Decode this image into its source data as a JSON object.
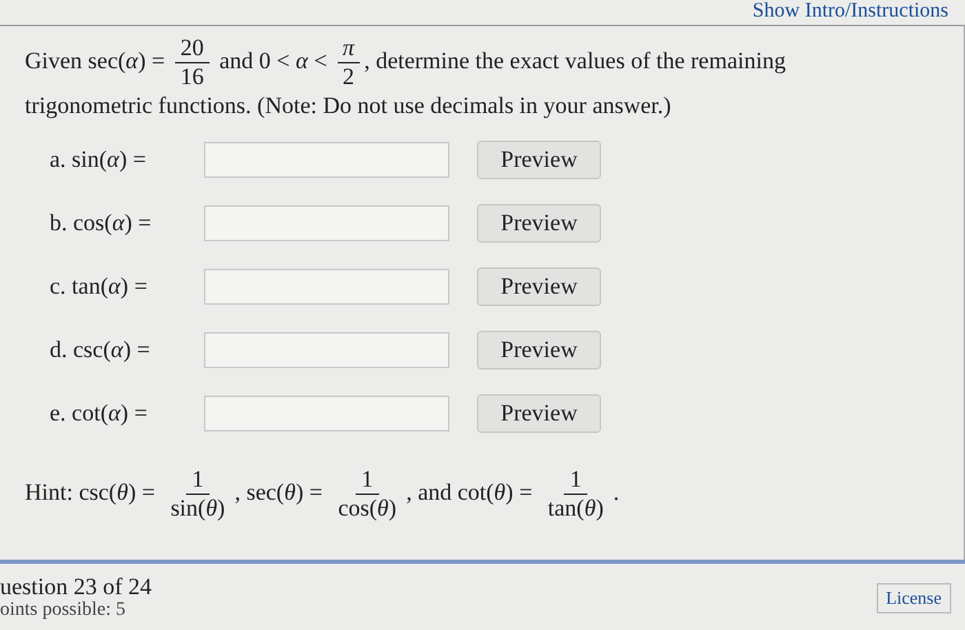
{
  "instructions_link": "Show Intro/Instructions",
  "question": [
    {
      "kind": "text",
      "text": "Given sec(*α*) = "
    },
    {
      "kind": "frac",
      "num": "20",
      "den": "16"
    },
    {
      "kind": "text",
      "text": " and 0 < *α* < "
    },
    {
      "kind": "frac",
      "num": "*π*",
      "den": "2"
    },
    {
      "kind": "text",
      "text": ", determine the exact values of the remaining"
    },
    {
      "kind": "line",
      "text": "trigonometric functions. (Note: Do not use decimals in your answer.)"
    }
  ],
  "answers": [
    {
      "label": "a. sin(*α*) =",
      "button": "Preview"
    },
    {
      "label": "b. cos(*α*) =",
      "button": "Preview"
    },
    {
      "label": "c. tan(*α*) =",
      "button": "Preview"
    },
    {
      "label": "d. csc(*α*) =",
      "button": "Preview"
    },
    {
      "label": "e. cot(*α*) =",
      "button": "Preview"
    }
  ],
  "hint": [
    {
      "kind": "text",
      "text": "Hint: csc(*θ*) = "
    },
    {
      "kind": "frac",
      "num": "1",
      "den": "sin(*θ*)"
    },
    {
      "kind": "text",
      "text": ", sec(*θ*) = "
    },
    {
      "kind": "frac",
      "num": "1",
      "den": "cos(*θ*)"
    },
    {
      "kind": "text",
      "text": ", and cot(*θ*) = "
    },
    {
      "kind": "frac",
      "num": "1",
      "den": "tan(*θ*)"
    },
    {
      "kind": "text",
      "text": "."
    }
  ],
  "footer": {
    "question_count": "uestion 23 of 24",
    "points": "oints possible: 5",
    "license": "License"
  }
}
